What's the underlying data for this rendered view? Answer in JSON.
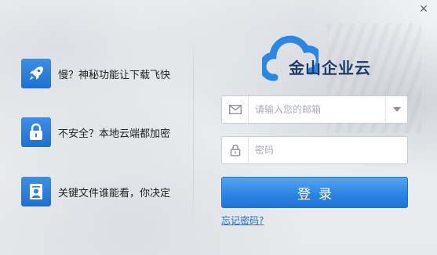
{
  "window": {
    "close_label": "✕"
  },
  "features": [
    {
      "icon": "rocket-icon",
      "text": "慢？神秘功能让下载飞快"
    },
    {
      "icon": "lock-icon",
      "text": "不安全？本地云端都加密"
    },
    {
      "icon": "user-card-icon",
      "text": "关键文件谁能看，你决定"
    }
  ],
  "logo": {
    "text": "金山企业云",
    "icon": "cloud-icon"
  },
  "form": {
    "email_placeholder": "请输入您的邮箱",
    "email_value": "",
    "password_placeholder": "密码",
    "password_value": "",
    "login_label": "登录",
    "forgot_label": "忘记密码?"
  },
  "colors": {
    "accent": "#2d86e3",
    "feature_icon_bg": "#2a7ddb",
    "link": "#1a6fcf",
    "logo_text": "#1a3a6a"
  }
}
